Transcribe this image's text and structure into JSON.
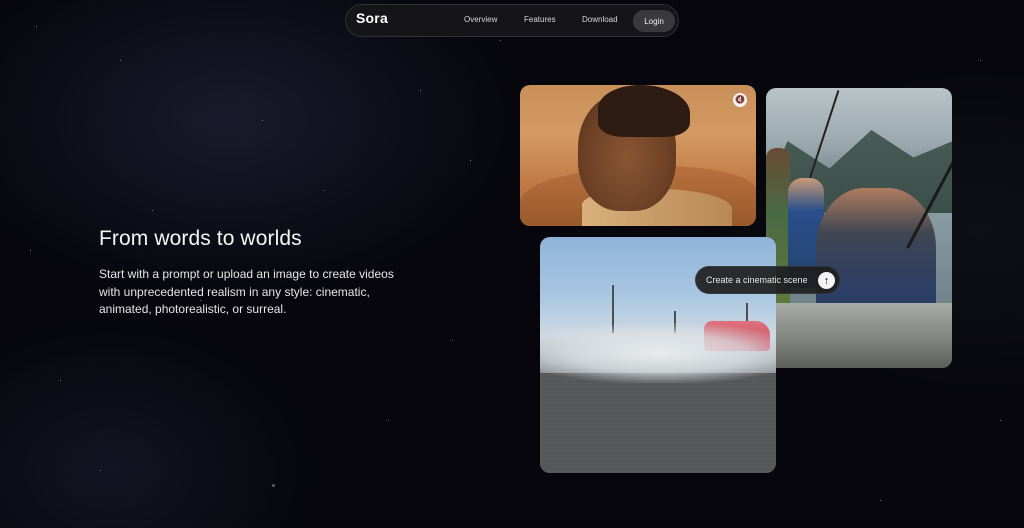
{
  "nav": {
    "logo": "Sora",
    "links": [
      "Overview",
      "Features",
      "Download"
    ],
    "login_label": "Login"
  },
  "hero": {
    "title": "From words to worlds",
    "description": "Start with a prompt or upload an image to create videos with unprecedented realism in any style: cinematic, animated, photorealistic, or surreal."
  },
  "prompt": {
    "placeholder": "Create a cinematic scene",
    "send_icon": "arrow-up-icon"
  },
  "media": {
    "mute_icon": "muted-speaker-icon"
  },
  "colors": {
    "background": "#06060c",
    "nav_bg": "#16161a",
    "login_bg": "#3a3a3e",
    "text": "#f5f5f5"
  }
}
